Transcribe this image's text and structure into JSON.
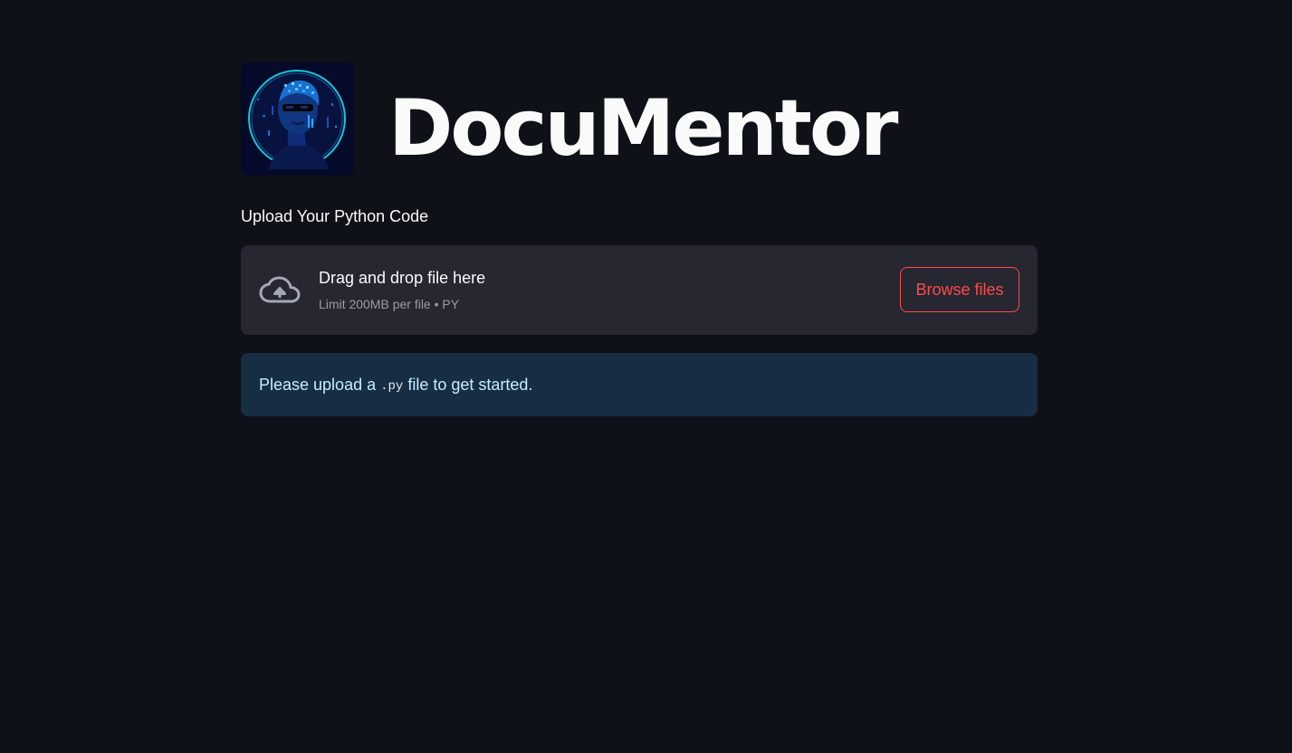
{
  "header": {
    "title": "DocuMentor",
    "logo_icon": "pixel-art-portrait"
  },
  "uploader": {
    "label": "Upload Your Python Code",
    "icon": "cloud-upload-icon",
    "drop_text": "Drag and drop file here",
    "limit_text": "Limit 200MB per file • PY",
    "browse_label": "Browse files"
  },
  "info": {
    "prefix": "Please upload a",
    "code": ".py",
    "suffix": "file to get started."
  },
  "colors": {
    "background": "#0e1117",
    "accent": "#ff4b4b",
    "dropzone": "#262730",
    "info_bg": "#172d43",
    "info_text": "#c7ebff"
  }
}
